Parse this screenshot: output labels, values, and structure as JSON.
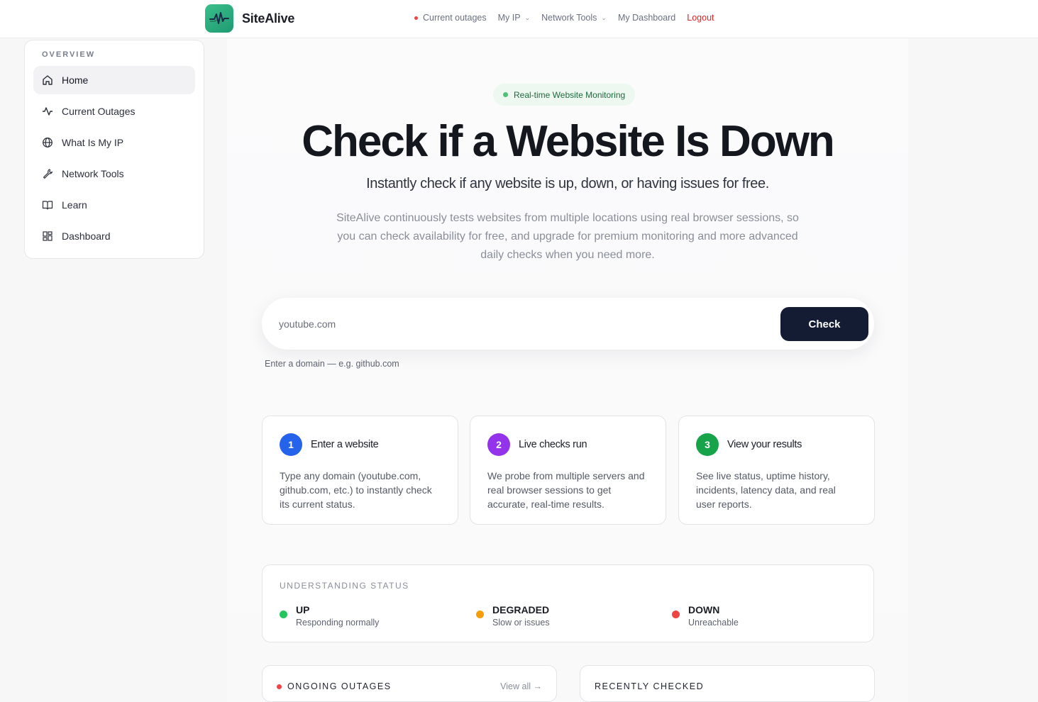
{
  "brand": {
    "name": "SiteAlive",
    "logo_icon": "pulse-icon",
    "logo_color": "#2fb07f"
  },
  "nav": {
    "current_outages": "Current outages",
    "my_ip": "My IP",
    "network_tools": "Network Tools",
    "my_dashboard": "My Dashboard",
    "logout": "Logout"
  },
  "sidebar": {
    "heading": "OVERVIEW",
    "items": [
      {
        "label": "Home",
        "icon": "home-icon",
        "active": true
      },
      {
        "label": "Current Outages",
        "icon": "activity-icon"
      },
      {
        "label": "What Is My IP",
        "icon": "globe-icon"
      },
      {
        "label": "Network Tools",
        "icon": "wrench-icon"
      },
      {
        "label": "Learn",
        "icon": "book-icon"
      },
      {
        "label": "Dashboard",
        "icon": "grid-icon"
      }
    ]
  },
  "hero": {
    "badge": "Real-time Website Monitoring",
    "title": "Check if a Website Is Down",
    "subtitle": "Instantly check if any website is up, down, or having issues for free.",
    "description": "SiteAlive continuously tests websites from multiple locations using real browser sessions, so you can check availability for free, and upgrade for premium monitoring and more advanced daily checks when you need more."
  },
  "search": {
    "placeholder": "youtube.com",
    "button": "Check",
    "hint": "Enter a domain — e.g. github.com"
  },
  "steps": [
    {
      "num": "1",
      "title": "Enter a website",
      "text": "Type any domain (youtube.com, github.com, etc.) to instantly check its current status.",
      "color": "#2563eb"
    },
    {
      "num": "2",
      "title": "Live checks run",
      "text": "We probe from multiple servers and real browser sessions to get accurate, real-time results.",
      "color": "#9333ea"
    },
    {
      "num": "3",
      "title": "View your results",
      "text": "See live status, uptime history, incidents, latency data, and real user reports.",
      "color": "#16a34a"
    }
  ],
  "status": {
    "heading": "UNDERSTANDING STATUS",
    "items": [
      {
        "label": "UP",
        "desc": "Responding normally",
        "color": "#22c55e"
      },
      {
        "label": "DEGRADED",
        "desc": "Slow or issues",
        "color": "#f59e0b"
      },
      {
        "label": "DOWN",
        "desc": "Unreachable",
        "color": "#ef4444"
      }
    ]
  },
  "outages": {
    "title": "ONGOING OUTAGES",
    "view_all": "View all →"
  },
  "recent": {
    "title": "RECENTLY CHECKED"
  }
}
